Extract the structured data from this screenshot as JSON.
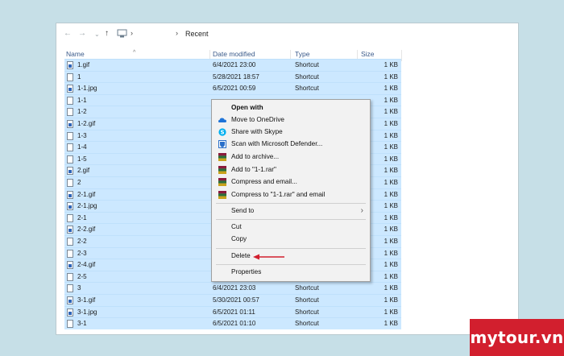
{
  "nav": {
    "back": "←",
    "forward": "→",
    "dropdown": "⌄",
    "up": "↑",
    "sep": "›",
    "location": "Recent"
  },
  "columns": {
    "name": "Name",
    "date": "Date modified",
    "type": "Type",
    "size": "Size"
  },
  "files": [
    {
      "name": "1.gif",
      "date": "6/4/2021 23:00",
      "type": "Shortcut",
      "size": "1 KB",
      "icon": "gif"
    },
    {
      "name": "1",
      "date": "5/28/2021 18:57",
      "type": "Shortcut",
      "size": "1 KB",
      "icon": "doc"
    },
    {
      "name": "1-1.jpg",
      "date": "6/5/2021 00:59",
      "type": "Shortcut",
      "size": "1 KB",
      "icon": "gif"
    },
    {
      "name": "1-1",
      "date": "",
      "type": "",
      "size": "1 KB",
      "icon": "doc"
    },
    {
      "name": "1-2",
      "date": "",
      "type": "",
      "size": "1 KB",
      "icon": "doc"
    },
    {
      "name": "1-2.gif",
      "date": "",
      "type": "",
      "size": "1 KB",
      "icon": "gif"
    },
    {
      "name": "1-3",
      "date": "",
      "type": "",
      "size": "1 KB",
      "icon": "doc"
    },
    {
      "name": "1-4",
      "date": "",
      "type": "",
      "size": "1 KB",
      "icon": "doc"
    },
    {
      "name": "1-5",
      "date": "",
      "type": "",
      "size": "1 KB",
      "icon": "doc"
    },
    {
      "name": "2.gif",
      "date": "",
      "type": "",
      "size": "1 KB",
      "icon": "gif"
    },
    {
      "name": "2",
      "date": "",
      "type": "",
      "size": "1 KB",
      "icon": "doc"
    },
    {
      "name": "2-1.gif",
      "date": "",
      "type": "",
      "size": "1 KB",
      "icon": "gif"
    },
    {
      "name": "2-1.jpg",
      "date": "",
      "type": "",
      "size": "1 KB",
      "icon": "gif"
    },
    {
      "name": "2-1",
      "date": "",
      "type": "",
      "size": "1 KB",
      "icon": "doc"
    },
    {
      "name": "2-2.gif",
      "date": "",
      "type": "",
      "size": "1 KB",
      "icon": "gif"
    },
    {
      "name": "2-2",
      "date": "",
      "type": "",
      "size": "1 KB",
      "icon": "doc"
    },
    {
      "name": "2-3",
      "date": "",
      "type": "",
      "size": "1 KB",
      "icon": "doc"
    },
    {
      "name": "2-4.gif",
      "date": "",
      "type": "",
      "size": "1 KB",
      "icon": "gif"
    },
    {
      "name": "2-5",
      "date": "",
      "type": "",
      "size": "1 KB",
      "icon": "doc"
    },
    {
      "name": "3",
      "date": "6/4/2021 23:03",
      "type": "Shortcut",
      "size": "1 KB",
      "icon": "doc"
    },
    {
      "name": "3-1.gif",
      "date": "5/30/2021 00:57",
      "type": "Shortcut",
      "size": "1 KB",
      "icon": "gif"
    },
    {
      "name": "3-1.jpg",
      "date": "6/5/2021 01:11",
      "type": "Shortcut",
      "size": "1 KB",
      "icon": "gif"
    },
    {
      "name": "3-1",
      "date": "6/5/2021 01:10",
      "type": "Shortcut",
      "size": "1 KB",
      "icon": "doc"
    }
  ],
  "context_menu": {
    "open_with": "Open with",
    "move_onedrive": "Move to OneDrive",
    "share_skype": "Share with Skype",
    "scan_defender": "Scan with Microsoft Defender...",
    "add_archive": "Add to archive...",
    "add_rar": "Add to \"1-1.rar\"",
    "compress_email": "Compress and email...",
    "compress_rar_email": "Compress to \"1-1.rar\" and email",
    "send_to": "Send to",
    "cut": "Cut",
    "copy": "Copy",
    "delete": "Delete",
    "properties": "Properties"
  },
  "colors": {
    "selection": "#cce8ff",
    "accent": "#d21f2e",
    "onedrive": "#1e73d8",
    "skype": "#00aff0"
  },
  "brand": "mytour.vn"
}
